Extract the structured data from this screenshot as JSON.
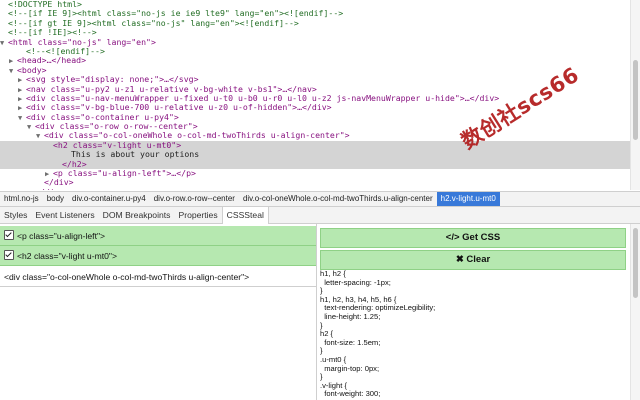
{
  "tree": {
    "lines": [
      {
        "indent": 0,
        "tri": "",
        "text": "<!DOCTYPE html>",
        "kind": "com"
      },
      {
        "indent": 0,
        "tri": "",
        "text": "<!--[if IE 9]><html class=\"no-js ie ie9 lte9\" lang=\"en\"><![endif]-->",
        "kind": "com"
      },
      {
        "indent": 0,
        "tri": "",
        "text": "<!--[if gt IE 9]><html class=\"no-js\" lang=\"en\"><![endif]-->",
        "kind": "com"
      },
      {
        "indent": 0,
        "tri": "",
        "text": "<!--[if !IE]><!-->",
        "kind": "com"
      },
      {
        "indent": 0,
        "tri": "▼",
        "text": "<html class=\"no-js\" lang=\"en\">",
        "kind": "tag"
      },
      {
        "indent": 2,
        "tri": "",
        "text": "<!--<![endif]-->",
        "kind": "com"
      },
      {
        "indent": 1,
        "tri": "▶",
        "text": "<head>…</head>",
        "kind": "tag"
      },
      {
        "indent": 1,
        "tri": "▼",
        "text": "<body>",
        "kind": "tag"
      },
      {
        "indent": 2,
        "tri": "▶",
        "text": "<svg style=\"display: none;\">…</svg>",
        "kind": "tag"
      },
      {
        "indent": 2,
        "tri": "▶",
        "text": "<nav class=\"u-py2 u-z1 u-relative v-bg-white v-bs1\">…</nav>",
        "kind": "tag"
      },
      {
        "indent": 2,
        "tri": "▶",
        "text": "<div class=\"u-nav-menuWrapper u-fixed u-t0 u-b0 u-r0 u-l0 u-z2 js-navMenuWrapper u-hide\">…</div>",
        "kind": "tag"
      },
      {
        "indent": 2,
        "tri": "▶",
        "text": "<div class=\"v-bg-blue-700 u-relative u-z0 u-of-hidden\">…</div>",
        "kind": "tag"
      },
      {
        "indent": 2,
        "tri": "▼",
        "text": "<div class=\"o-container u-py4\">",
        "kind": "tag"
      },
      {
        "indent": 3,
        "tri": "▼",
        "text": "<div class=\"o-row o-row--center\">",
        "kind": "tag"
      },
      {
        "indent": 4,
        "tri": "▼",
        "text": "<div class=\"o-col-oneWhole o-col-md-twoThirds u-align-center\">",
        "kind": "tag"
      },
      {
        "indent": 5,
        "tri": "",
        "text": "<h2 class=\"v-light u-mt0\">",
        "kind": "tag",
        "hl": true
      },
      {
        "indent": 7,
        "tri": "",
        "text": "This is about your options",
        "kind": "txt",
        "hl": true
      },
      {
        "indent": 6,
        "tri": "",
        "text": "</h2>",
        "kind": "tag",
        "hl": true
      },
      {
        "indent": 5,
        "tri": "▶",
        "text": "<p class=\"u-align-left\">…</p>",
        "kind": "tag"
      },
      {
        "indent": 4,
        "tri": "",
        "text": "</div>",
        "kind": "tag"
      },
      {
        "indent": 3,
        "tri": "",
        "text": "</div>",
        "kind": "tag"
      }
    ]
  },
  "breadcrumbs": [
    {
      "label": "html.no-js",
      "selected": false
    },
    {
      "label": "body",
      "selected": false
    },
    {
      "label": "div.o-container.u-py4",
      "selected": false
    },
    {
      "label": "div.o-row.o-row--center",
      "selected": false
    },
    {
      "label": "div.o-col-oneWhole.o-col-md-twoThirds.u-align-center",
      "selected": false
    },
    {
      "label": "h2.v-light.u-mt0",
      "selected": true
    }
  ],
  "tabs": [
    {
      "label": "Styles",
      "active": false
    },
    {
      "label": "Event Listeners",
      "active": false
    },
    {
      "label": "DOM Breakpoints",
      "active": false
    },
    {
      "label": "Properties",
      "active": false
    },
    {
      "label": "CSSSteal",
      "active": true
    }
  ],
  "left_panel": {
    "selected_rows": [
      {
        "label": "<p class=\"u-align-left\">",
        "checked": true
      },
      {
        "label": "<h2 class=\"v-light u-mt0\">",
        "checked": true
      }
    ],
    "plain_row": "<div class=\"o-col-oneWhole o-col-md-twoThirds u-align-center\">"
  },
  "right_panel": {
    "get_css_label": "</> Get CSS",
    "clear_label": "✖ Clear",
    "css_lines": [
      "h1, h2 {",
      "  letter-spacing: -1px;",
      "}",
      "h1, h2, h3, h4, h5, h6 {",
      "  text-rendering: optimizeLegibility;",
      "  line-height: 1.25;",
      "}",
      "h2 {",
      "  font-size: 1.5em;",
      "}",
      ".u-mt0 {",
      "  margin-top: 0px;",
      "}",
      ".v-light {",
      "  font-weight: 300;"
    ]
  },
  "watermark": "数创社scs66"
}
